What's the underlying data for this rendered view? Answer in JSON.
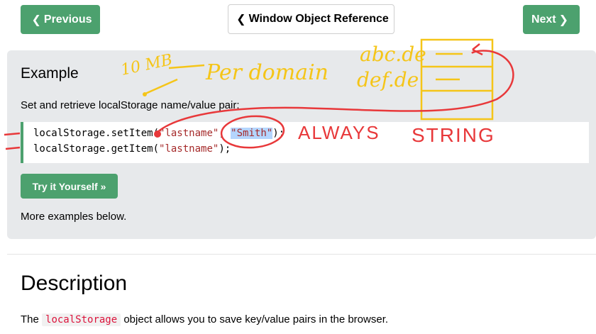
{
  "nav": {
    "previous_label": "Previous",
    "reference_label": "Window Object Reference",
    "next_label": "Next"
  },
  "example": {
    "title": "Example",
    "description": "Set and retrieve localStorage name/value pair:",
    "code": {
      "line1_prefix": "localStorage.setItem(",
      "line1_arg1": "\"lastname\"",
      "line1_sep": ", ",
      "line1_arg2": "\"Smith\"",
      "line1_suffix": ");",
      "line2_prefix": "localStorage.getItem(",
      "line2_arg1": "\"lastname\"",
      "line2_suffix": ");"
    },
    "try_button": "Try it Yourself »",
    "more_text": "More examples below."
  },
  "description": {
    "title": "Description",
    "text_before": "The ",
    "keyword": "localStorage",
    "text_after": " object allows you to save key/value pairs in the browser."
  },
  "annotations": {
    "size": "10 MB",
    "per_domain": "Per domain",
    "domain1": "abc.de",
    "domain2": "def.de",
    "always": "ALWAYS",
    "string": "STRING"
  },
  "colors": {
    "green": "#4CA16E",
    "panel_bg": "#E7E9EB",
    "code_string": "#A52A2A",
    "keyword_red": "#DC143C",
    "annotation_yellow": "#F5C518",
    "annotation_red": "#E8383A"
  },
  "icons": {
    "previous": "chevron-left-icon",
    "reference": "chevron-left-icon",
    "next": "chevron-right-icon"
  }
}
